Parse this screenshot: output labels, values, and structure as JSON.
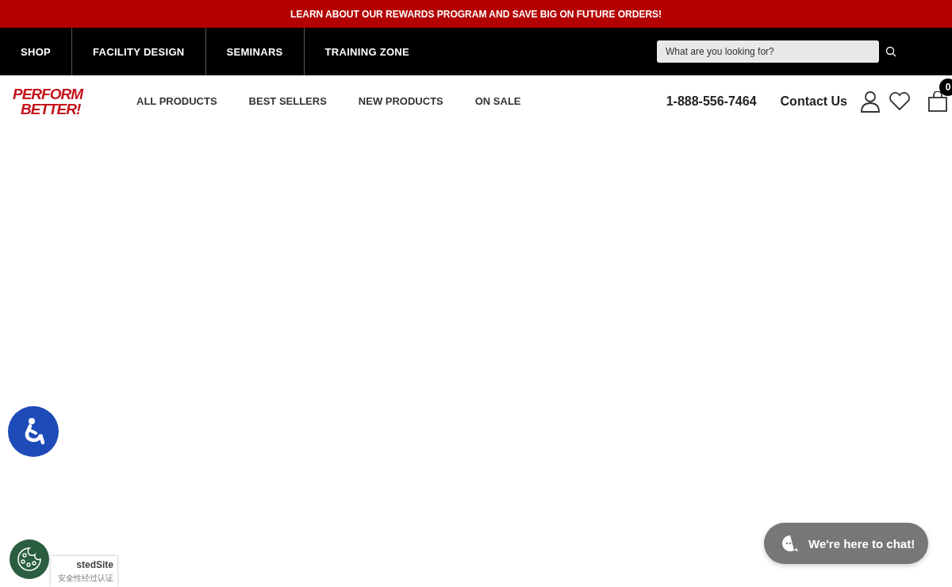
{
  "promo_bar": {
    "text": "LEARN ABOUT OUR REWARDS PROGRAM AND SAVE BIG ON FUTURE ORDERS!"
  },
  "top_nav": {
    "items": [
      "SHOP",
      "FACILITY DESIGN",
      "SEMINARS",
      "TRAINING ZONE"
    ],
    "search": {
      "placeholder": "What are you looking for?"
    }
  },
  "header": {
    "logo": [
      "PERFORM",
      "BETTER!"
    ],
    "menu": [
      "ALL PRODUCTS",
      "BEST SELLERS",
      "NEW PRODUCTS",
      "ON SALE"
    ],
    "phone": "1-888-556-7464",
    "contact": "Contact Us",
    "cart_count": "0"
  },
  "trusted_badge": {
    "brand": "stedSite",
    "caption": "安全性经过认证"
  },
  "chat": {
    "label": "We're here to chat!"
  }
}
